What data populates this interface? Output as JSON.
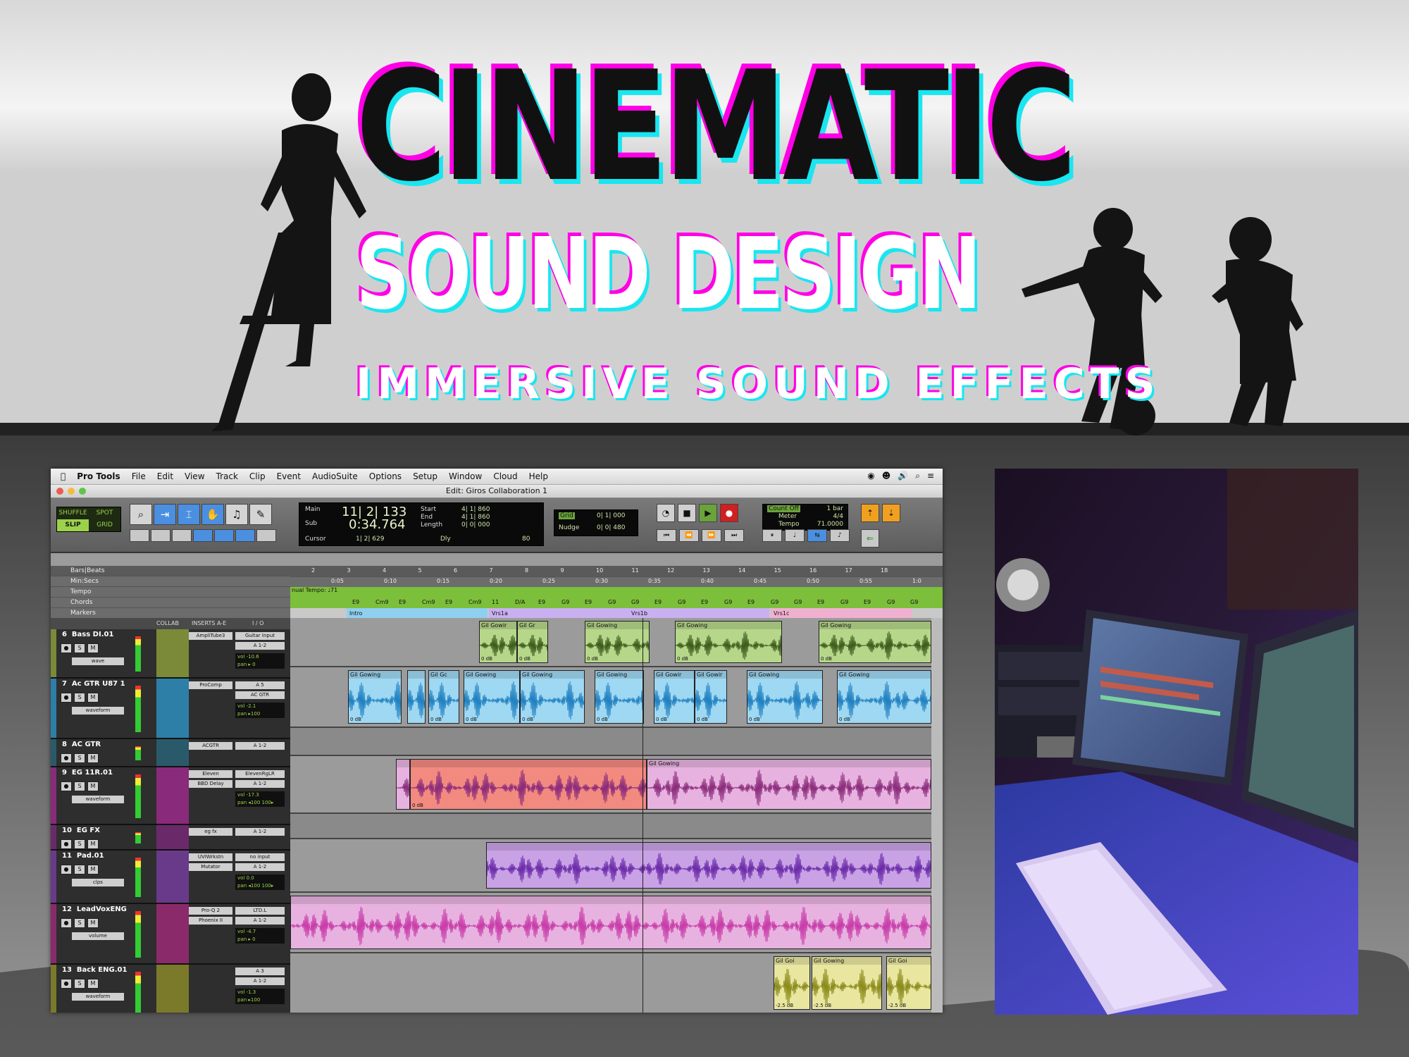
{
  "hero": {
    "title": "CINEMATIC",
    "subtitle": "SOUND DESIGN",
    "tagline": "IMMERSIVE SOUND EFFECTS"
  },
  "colors": {
    "magenta": "#ff00e6",
    "cyan": "#19e6f0",
    "green_clip": "#b6d78a",
    "blue_clip": "#9fd8f2",
    "pink_clip": "#e7b2e0",
    "red_clip": "#f28a80",
    "purple_clip": "#c9a2e6",
    "yellow_clip": "#e9e6a0"
  },
  "menubar": {
    "apple": "",
    "app": "Pro Tools",
    "items": [
      "File",
      "Edit",
      "View",
      "Track",
      "Clip",
      "Event",
      "AudioSuite",
      "Options",
      "Setup",
      "Window",
      "Cloud",
      "Help"
    ]
  },
  "window": {
    "title": "Edit: Giros Collaboration 1"
  },
  "modes": {
    "shuffle": "SHUFFLE",
    "spot": "SPOT",
    "slip": "SLIP",
    "grid": "GRID"
  },
  "counter": {
    "main_label": "Main",
    "main_value": "11| 2| 133",
    "sub_label": "Sub",
    "sub_value": "0:34.764",
    "start_label": "Start",
    "start_value": "4| 1| 860",
    "end_label": "End",
    "end_value": "4| 1| 860",
    "length_label": "Length",
    "length_value": "0| 0| 000",
    "cursor_label": "Cursor",
    "cursor_value": "1| 2| 629",
    "dly": "Dly",
    "bpm_value": "80"
  },
  "grid": {
    "grid_label": "Grid",
    "grid_value": "0| 1| 000",
    "nudge_label": "Nudge",
    "nudge_value": "0| 0| 480"
  },
  "meter": {
    "count_off": "Count Off",
    "count_bars": "1 bar",
    "meter_label": "Meter",
    "meter_value": "4/4",
    "tempo_label": "Tempo",
    "tempo_value": "71.0000"
  },
  "rulers": {
    "bars_label": "Bars|Beats",
    "min_label": "Min:Secs",
    "tempo_label": "Tempo",
    "chords_label": "Chords",
    "markers_label": "Markers",
    "bars": [
      "2",
      "3",
      "4",
      "5",
      "6",
      "7",
      "8",
      "9",
      "10",
      "11",
      "12",
      "13",
      "14",
      "15",
      "16",
      "17",
      "18"
    ],
    "secs": [
      "0:05",
      "0:10",
      "0:15",
      "0:20",
      "0:25",
      "0:30",
      "0:35",
      "0:40",
      "0:45",
      "0:50",
      "0:55",
      "1:0"
    ],
    "tempo_text": "nual Tempo: ♩71",
    "chords": [
      "E9",
      "Cm9",
      "E9",
      "Cm9",
      "E9",
      "Cm9",
      "11",
      "D/A",
      "E9",
      "G9",
      "E9",
      "G9",
      "G9",
      "E9",
      "G9",
      "E9",
      "G9",
      "E9",
      "G9",
      "G9",
      "E9",
      "G9",
      "E9",
      "G9",
      "G9"
    ],
    "markers": [
      "Intro",
      "Vrs1a",
      "Vrs1b",
      "Vrs1c"
    ]
  },
  "header": {
    "collab": "COLLAB",
    "inserts": "INSERTS A-E",
    "io": "I / O"
  },
  "tracks": [
    {
      "num": "6",
      "name": "Bass DI.01",
      "view": "wave",
      "auto": "read",
      "insert1": "AmpliTube3",
      "insert2": "",
      "io1": "Guitar Input",
      "io2": "A 1-2",
      "vol": "-10.6",
      "pan": "▸ 0",
      "color": "#7a8a38",
      "lane": "#9b9b9b"
    },
    {
      "num": "7",
      "name": "Ac GTR U87 1",
      "view": "waveform",
      "auto": "read",
      "insert1": "ProComp",
      "insert2": "",
      "io1": "A 5",
      "io2": "AC GTR",
      "vol": "-2.1",
      "pan": "▸100",
      "color": "#2d7fa8",
      "lane": "#9b9b9b"
    },
    {
      "num": "8",
      "name": "AC GTR",
      "view": "pan L",
      "auto": "read",
      "insert1": "ACGTR",
      "insert2": "",
      "io1": "A 1-2",
      "io2": "",
      "vol": "-0.4",
      "pan": "P P",
      "color": "#2a5a6a",
      "lane": "#8a8a8a"
    },
    {
      "num": "9",
      "name": "EG 11R.01",
      "view": "waveform",
      "auto": "read",
      "insert1": "Eleven",
      "insert2": "BBD Delay",
      "io1": "ElevenRgLR",
      "io2": "A 1-2",
      "vol": "-17.3",
      "pan": "◂100 100▸",
      "color": "#8a2a7a",
      "lane": "#9b9b9b"
    },
    {
      "num": "10",
      "name": "EG FX",
      "view": "vol",
      "auto": "read",
      "insert1": "eg fx",
      "insert2": "",
      "io1": "A 1-2",
      "io2": "",
      "vol": "0.0",
      "pan": "P P",
      "color": "#6a2a6a",
      "lane": "#8a8a8a"
    },
    {
      "num": "11",
      "name": "Pad.01",
      "view": "clps",
      "auto": "read",
      "insert1": "UVIWrkstn",
      "insert2": "Mutator",
      "io1": "no input",
      "io2": "A 1-2",
      "vol": "0.0",
      "pan": "◂100 100▸",
      "color": "#6a3a8a",
      "lane": "#9b9b9b"
    },
    {
      "num": "12",
      "name": "LeadVoxENG",
      "view": "volume",
      "auto": "read",
      "insert1": "Pro-Q 2",
      "insert2": "Phoenix II",
      "io1": "LTD.L",
      "io2": "A 1-2",
      "vol": "-4.7",
      "pan": "▸ 0",
      "color": "#8a2a6a",
      "lane": "#9b9b9b"
    },
    {
      "num": "13",
      "name": "Back ENG.01",
      "view": "waveform",
      "auto": "read",
      "insert1": "",
      "insert2": "",
      "io1": "A 3",
      "io2": "A 1-2",
      "vol": "-1.3",
      "pan": "▸100",
      "color": "#7a7a2a",
      "lane": "#9b9b9b"
    }
  ],
  "clips": {
    "name": "Gil Gowing",
    "short1": "Gil Gowir",
    "short2": "Gil Gr",
    "short3": "Gil Gc",
    "short4": "Gil Goi",
    "db0": "0 dB",
    "db25": "-2.5 dB"
  }
}
